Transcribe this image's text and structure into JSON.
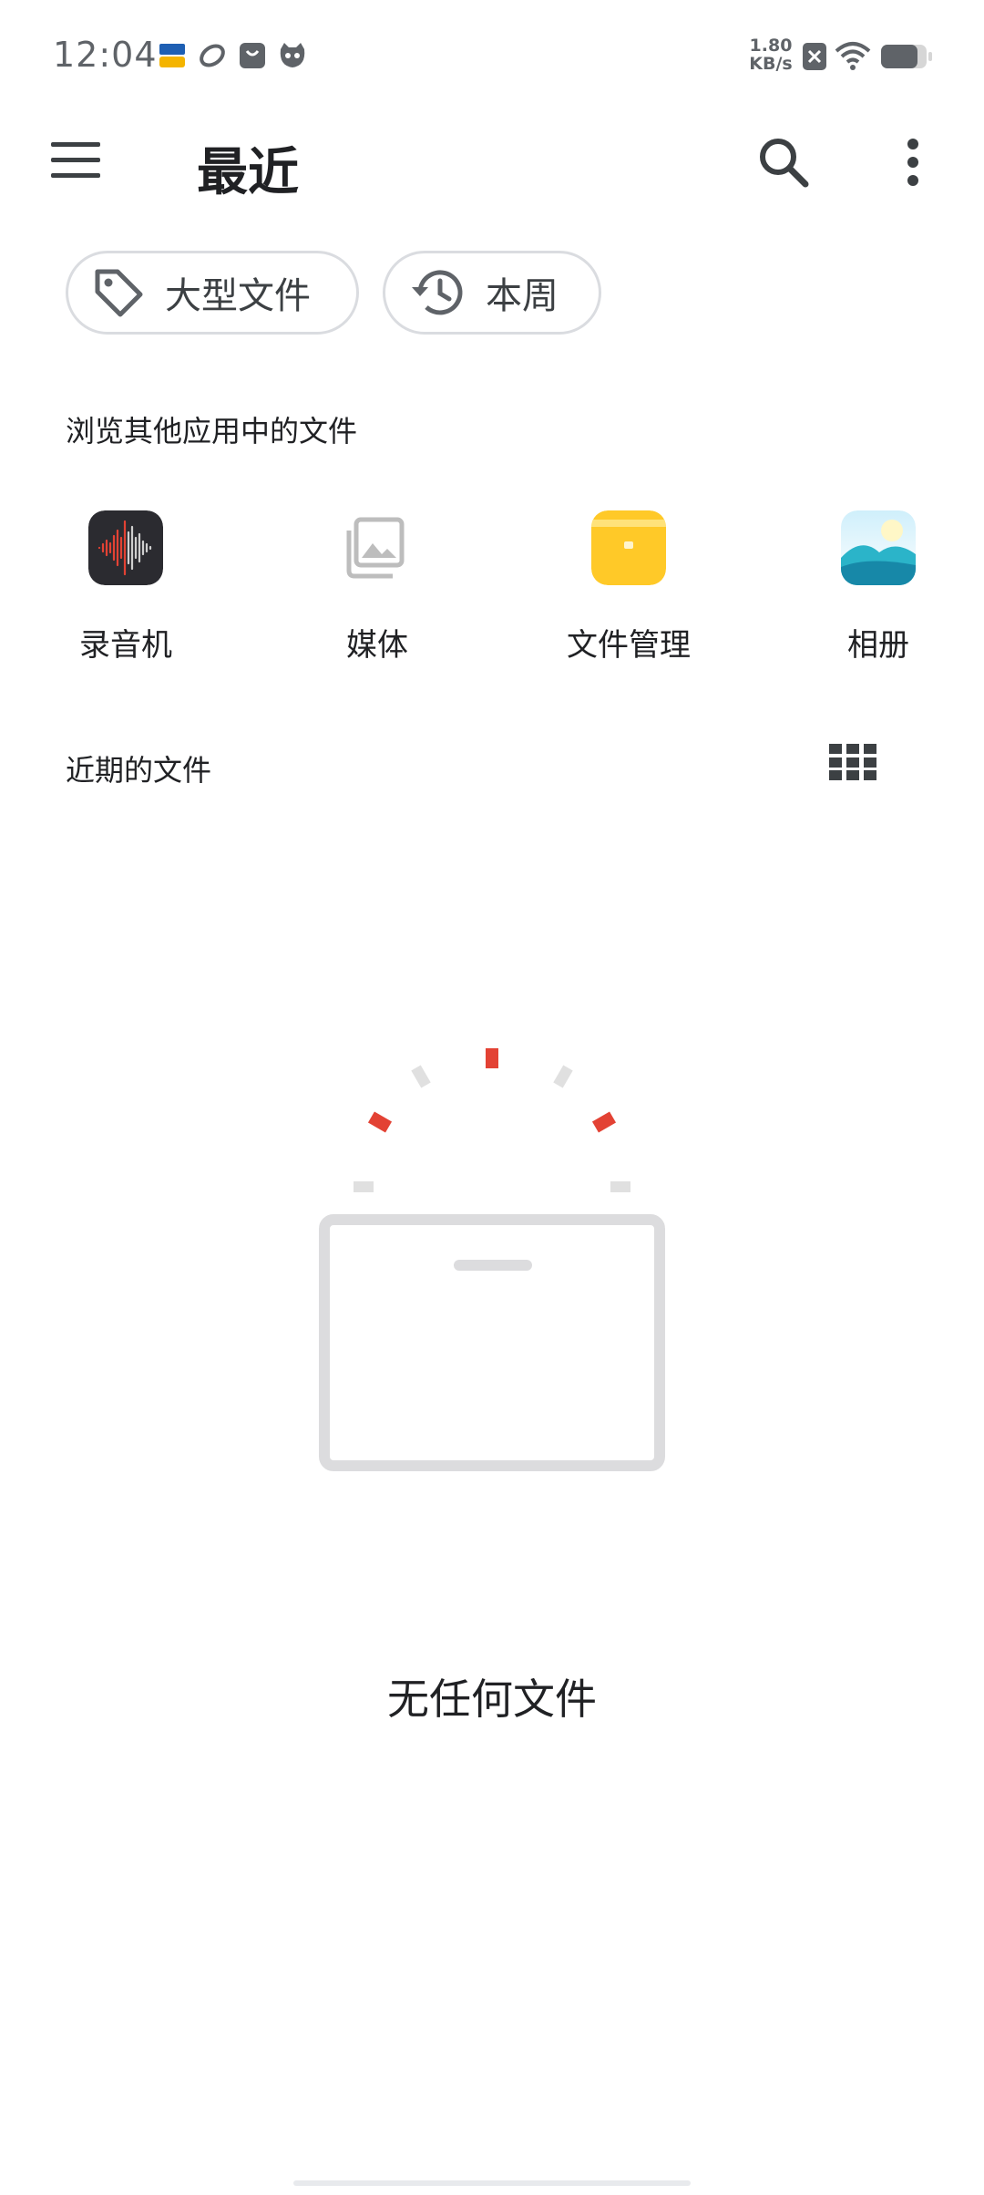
{
  "status_bar": {
    "time": "12:04",
    "net_speed_value": "1.80",
    "net_speed_unit": "KB/s",
    "notification_icons": [
      "1905-app-icon",
      "swirl-app-icon",
      "shopping-bag-icon",
      "cat-mascot-icon"
    ],
    "system_icons": [
      "sim-off-icon",
      "wifi-icon",
      "battery-icon"
    ]
  },
  "app_bar": {
    "title": "最近",
    "menu_icon": "menu-icon",
    "search_icon": "search-icon",
    "more_icon": "more-vert-icon"
  },
  "chips": [
    {
      "label": "大型文件",
      "icon": "tag-icon"
    },
    {
      "label": "本周",
      "icon": "history-icon"
    }
  ],
  "browse_section": {
    "label": "浏览其他应用中的文件",
    "apps": [
      {
        "label": "录音机",
        "icon": "voice-recorder-icon"
      },
      {
        "label": "媒体",
        "icon": "media-gallery-icon"
      },
      {
        "label": "文件管理",
        "icon": "file-manager-icon"
      },
      {
        "label": "相册",
        "icon": "album-icon"
      }
    ]
  },
  "recent_section": {
    "label": "近期的文件",
    "view_toggle_icon": "grid-view-icon"
  },
  "empty_state": {
    "text": "无任何文件",
    "illustration": "empty-box-icon"
  },
  "colors": {
    "accent_red": "#e34234",
    "folder_yellow": "#fbc02d",
    "text": "#202124",
    "outline": "#dadce0"
  }
}
